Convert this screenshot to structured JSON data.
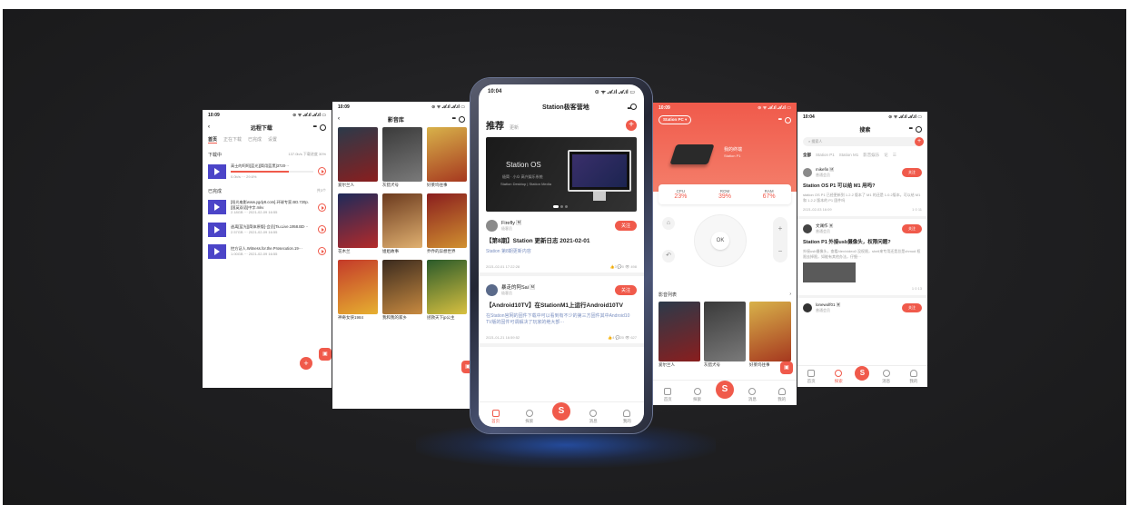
{
  "colors": {
    "accent": "#f05a4b",
    "background": "#1f1f21",
    "glow": "#286eff"
  },
  "phone1": {
    "time": "10:09",
    "signal": "⊙ ᯤ 𝒜.ıl 𝒜.ıl ▭",
    "title": "远程下载",
    "tabs": [
      "首页",
      "正在下载",
      "已完成",
      "设置"
    ],
    "downloading_label": "下载中",
    "downloading_meta": "137.0b/s 下载进度 30%",
    "downloading": [
      {
        "name": "高士的呵呵[蓝光][简用蓝黑]3720··· ",
        "meta": "0.0b/s ··· 29.6%",
        "progress": 0.7
      }
    ],
    "done_label": "已完成",
    "done_meta": "共3个",
    "done": [
      {
        "name": "[阳光电影www.ygdy8.com].环球专家.BD.720p.[国英双语]中字.mkv",
        "meta": "2.18GB ··· 2021-02-09 16:55"
      },
      {
        "name": "逃离[蓝光][简体原版]·会员[Tiu.Live.1958.BD···",
        "meta": "2.57GB ··· 2021-02-09 16:55"
      },
      {
        "name": "控方证人.Witness.for.the.Prosecution.19···",
        "meta": "1.00GB ··· 2021-02-09 16:55"
      }
    ]
  },
  "phone2": {
    "time": "10:09",
    "title": "影音库",
    "movies": [
      {
        "title": "爱尔兰人",
        "c1": "#2b3a4a",
        "c2": "#8a1e1e"
      },
      {
        "title": "灰猎犬号",
        "c1": "#3a3a3a",
        "c2": "#7a7a7a"
      },
      {
        "title": "好莱坞往事",
        "c1": "#d8b24a",
        "c2": "#a6381f"
      },
      {
        "title": "花木兰",
        "c1": "#1e2a5a",
        "c2": "#b42a2a"
      },
      {
        "title": "姐姐故事",
        "c1": "#6b3a1e",
        "c2": "#e0b070"
      },
      {
        "title": "乔乔的异想世界",
        "c1": "#8a1e1e",
        "c2": "#d09030"
      },
      {
        "title": "神奇女侠1984",
        "c1": "#c43a2a",
        "c2": "#e6b030"
      },
      {
        "title": "我和我的家乡",
        "c1": "#3a2a1e",
        "c2": "#c88a40"
      },
      {
        "title": "拯救天下jp公主",
        "c1": "#2a5a2a",
        "c2": "#d8c040"
      }
    ]
  },
  "phone3": {
    "time": "10:04",
    "signal": "⊙ ᯤ 𝒜.ıl 𝒜.ıl ▭",
    "title": "Station极客营地",
    "heading": "推荐",
    "heading_sub": "更新",
    "banner": {
      "line1": "Station OS",
      "line2": "极简 · 小众 高兴娱乐系统",
      "line3": "Station Desktop | Station Media"
    },
    "posts": [
      {
        "author": "Firefly 🄼",
        "sub": "极客员",
        "follow": "关注",
        "title": "【第8期】Station 更新日志 2021-02-01",
        "body": "Station 第8期更新内容",
        "date": "2021-02-01 17:22:28",
        "stats": "👍3  💬0  👁 498"
      },
      {
        "author": "暴走的阿Sai 🄼",
        "sub": "极客员",
        "follow": "关注",
        "title": "【Android10TV】在StationM1上运行Android10TV",
        "body": "在Station官网的固件下载中可以看到有不少的第三方固件其中Android10 TV版的固件可谓解决了玩家的绝大部···",
        "date": "2021-01-21 16:59:52",
        "stats": "👍4  💬20  👁 627"
      }
    ],
    "tabs": [
      "首页",
      "探索",
      "",
      "消息",
      "我的"
    ],
    "center": "S"
  },
  "phone4": {
    "time": "10:09",
    "station_pill": "Station PC ▾",
    "device_name": "我的终端",
    "device_sub": "Station P1",
    "stats": [
      {
        "label": "CPU",
        "value": "23%"
      },
      {
        "label": "ROM",
        "value": "39%"
      },
      {
        "label": "RAM",
        "value": "67%"
      }
    ],
    "ok": "OK",
    "list_label": "影音列表",
    "movies": [
      {
        "title": "爱尔兰人",
        "c1": "#2b3a4a",
        "c2": "#8a1e1e"
      },
      {
        "title": "灰猎犬号",
        "c1": "#3a3a3a",
        "c2": "#7a7a7a"
      },
      {
        "title": "好莱坞往事",
        "c1": "#d8b24a",
        "c2": "#a6381f"
      }
    ],
    "tabs": [
      "首页",
      "探索",
      "",
      "消息",
      "我的"
    ],
    "center": "S"
  },
  "phone5": {
    "time": "10:04",
    "title": "搜索",
    "search_placeholder": "搜索人",
    "cats": [
      "全部",
      "Station P1",
      "Station M1",
      "影音娱乐",
      "论"
    ],
    "questions": [
      {
        "author": "mikefin 🄼",
        "sub": "普通会员",
        "title": "Station OS P1 可以给 M1 用吗?",
        "body": "station OS P1 已经更新到 1.2.2 版本了 M1 的还是 1.0.2版本。可以给 M1 和 1.2.2 版本的 P1 固件吗",
        "date": "2021-02-03 16:09",
        "stats": "1  0  11",
        "img": false
      },
      {
        "author": "文澜作 🄼",
        "sub": "普通会员",
        "title": "Station P1 外接usb摄像头，权限问题?",
        "body": "外接usb摄像头，查看/dev/video0 没权限，shell来专用还是总是chmod 权限去掉限，如能有其他办法，仔细···",
        "date": "",
        "stats": "1  0  13",
        "img": true
      },
      {
        "author": "lonewolf01 🄼",
        "sub": "普通会员",
        "title": "",
        "body": "",
        "date": "",
        "stats": "",
        "img": false
      }
    ],
    "follow": "关注",
    "tabs": [
      "首页",
      "探索",
      "",
      "消息",
      "我的"
    ],
    "center": "S"
  }
}
